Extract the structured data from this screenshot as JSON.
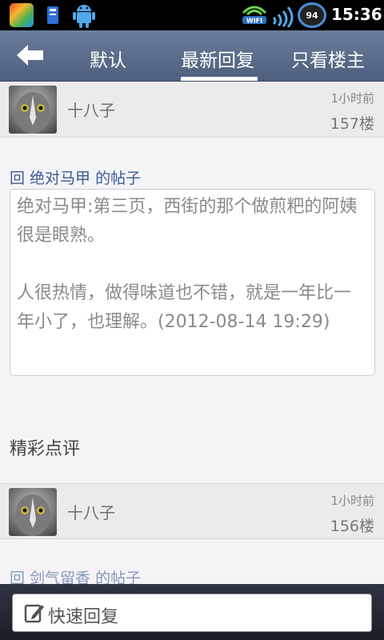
{
  "status_bar": {
    "battery_level": "94",
    "time": "15:36",
    "wifi_label": "WIFI"
  },
  "nav": {
    "tabs": [
      "默认",
      "最新回复",
      "只看楼主"
    ],
    "active_tab": "最新回复"
  },
  "posts": [
    {
      "username": "十八子",
      "time": "1小时前",
      "floor": "157楼",
      "reply_to": "回 绝对马甲 的帖子",
      "quote": "绝对马甲:第三页，西街的那个做煎粑的阿姨很是眼熟。\n\n人很热情，做得味道也不错，就是一年比一年小了，也理解。(2012-08-14 19:29)"
    },
    {
      "username": "十八子",
      "time": "1小时前",
      "floor": "156楼",
      "reply_to": "回 剑气留香 的帖子"
    }
  ],
  "section_title": "精彩点评",
  "bottom": {
    "quick_reply_label": "快速回复"
  }
}
